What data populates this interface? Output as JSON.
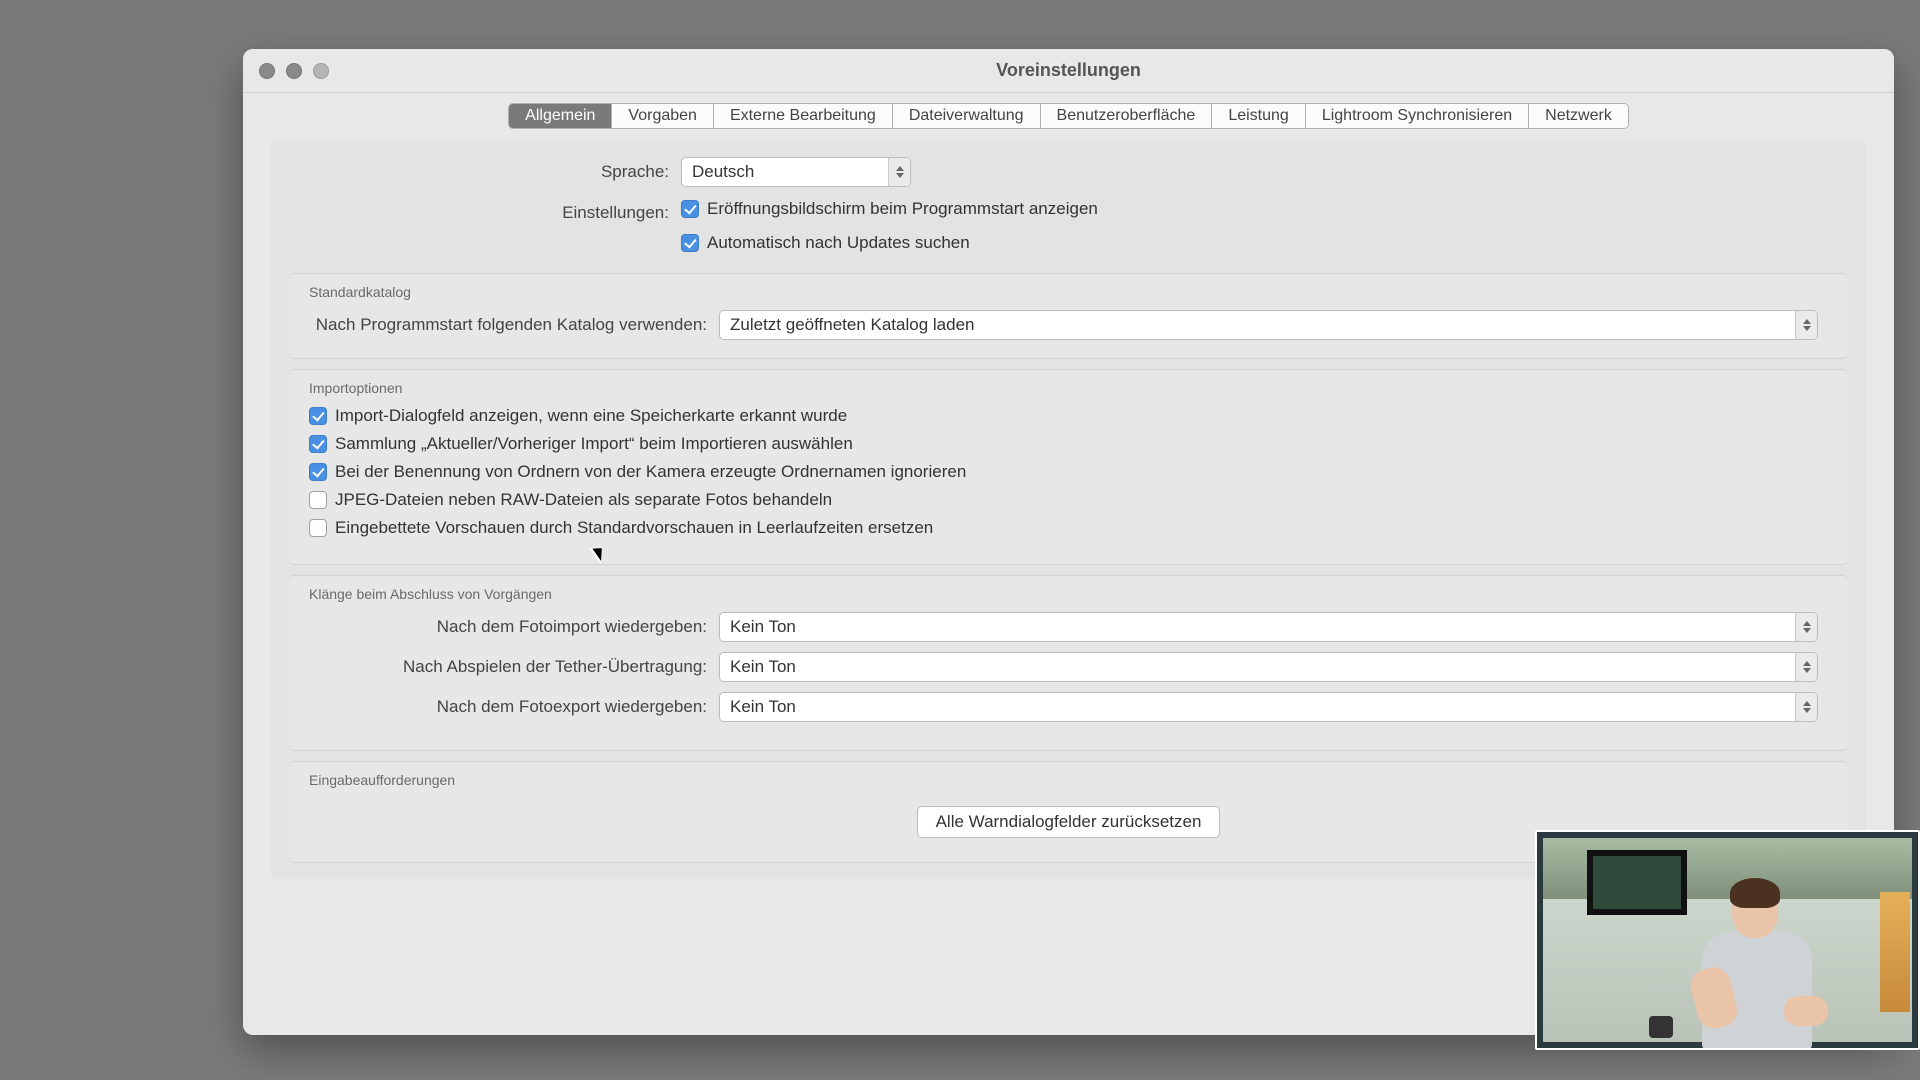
{
  "window": {
    "title": "Voreinstellungen"
  },
  "tabs": [
    "Allgemein",
    "Vorgaben",
    "Externe Bearbeitung",
    "Dateiverwaltung",
    "Benutzeroberfläche",
    "Leistung",
    "Lightroom Synchronisieren",
    "Netzwerk"
  ],
  "active_tab_index": 0,
  "general": {
    "language_label": "Sprache:",
    "language_value": "Deutsch",
    "settings_label": "Einstellungen:",
    "show_splash": {
      "checked": true,
      "label": "Eröffnungsbildschirm beim Programmstart anzeigen"
    },
    "auto_updates": {
      "checked": true,
      "label": "Automatisch nach Updates suchen"
    }
  },
  "default_catalog": {
    "section_title": "Standardkatalog",
    "label": "Nach Programmstart folgenden Katalog verwenden:",
    "value": "Zuletzt geöffneten Katalog laden"
  },
  "import_options": {
    "section_title": "Importoptionen",
    "items": [
      {
        "checked": true,
        "label": "Import-Dialogfeld anzeigen, wenn eine Speicherkarte erkannt wurde"
      },
      {
        "checked": true,
        "label": "Sammlung „Aktueller/Vorheriger Import“ beim Importieren auswählen"
      },
      {
        "checked": true,
        "label": "Bei der Benennung von Ordnern von der Kamera erzeugte Ordnernamen ignorieren"
      },
      {
        "checked": false,
        "label": "JPEG-Dateien neben RAW-Dateien als separate Fotos behandeln"
      },
      {
        "checked": false,
        "label": "Eingebettete Vorschauen durch Standardvorschauen in Leerlaufzeiten ersetzen"
      }
    ]
  },
  "sounds": {
    "section_title": "Klänge beim Abschluss von Vorgängen",
    "rows": [
      {
        "label": "Nach dem Fotoimport wiedergeben:",
        "value": "Kein Ton"
      },
      {
        "label": "Nach Abspielen der Tether-Übertragung:",
        "value": "Kein Ton"
      },
      {
        "label": "Nach dem Fotoexport wiedergeben:",
        "value": "Kein Ton"
      }
    ]
  },
  "prompts": {
    "section_title": "Eingabeaufforderungen",
    "reset_button": "Alle Warndialogfelder zurücksetzen"
  }
}
